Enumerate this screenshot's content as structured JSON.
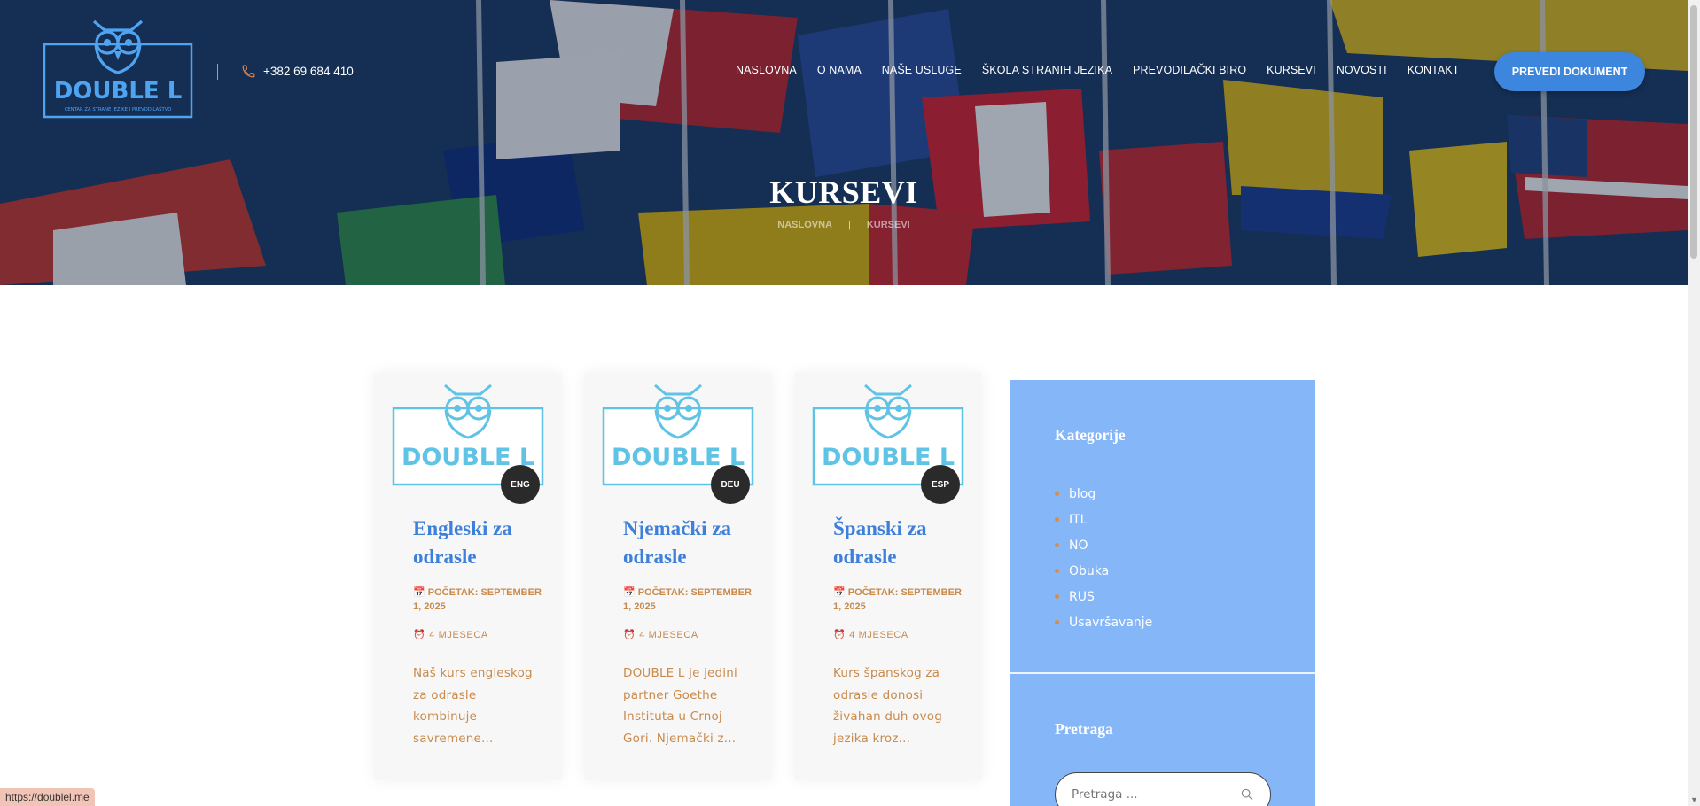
{
  "header": {
    "logo_text": "DOUBLE L",
    "logo_tagline": "CENTAR ZA STRANE JEZIKE I PREVODILAŠTVO",
    "phone": "+382 69 684 410",
    "nav": [
      "NASLOVNA",
      "O NAMA",
      "NAŠE USLUGE",
      "ŠKOLA STRANIH JEZIKA",
      "PREVODILAČKI BIRO",
      "KURSEVI",
      "NOVOSTI",
      "KONTAKT"
    ],
    "cta": "PREVEDI DOKUMENT",
    "page_title": "KURSEVI",
    "breadcrumb": [
      "NASLOVNA",
      "KURSEVI"
    ]
  },
  "courses": [
    {
      "badge": "ENG",
      "title": "Engleski za odrasle",
      "start": "POČETAK: SEPTEMBER 1, 2025",
      "duration": "4 MJESECA",
      "excerpt": "Naš kurs engleskog za odrasle kombinuje savremene..."
    },
    {
      "badge": "DEU",
      "title": "Njemački za odrasle",
      "start": "POČETAK: SEPTEMBER 1, 2025",
      "duration": "4 MJESECA",
      "excerpt": "DOUBLE L je jedini partner Goethe Instituta u Crnoj Gori. Njemački z..."
    },
    {
      "badge": "ESP",
      "title": "Španski za odrasle",
      "start": "POČETAK: SEPTEMBER 1, 2025",
      "duration": "4 MJESECA",
      "excerpt": "Kurs španskog za odrasle donosi živahan duh ovog jezika kroz..."
    }
  ],
  "sidebar": {
    "categories_title": "Kategorije",
    "categories": [
      "blog",
      "ITL",
      "NO",
      "Obuka",
      "RUS",
      "Usavršavanje"
    ],
    "search_title": "Pretraga",
    "search_placeholder": "Pretraga ..."
  },
  "status_url": "https://doublel.me",
  "colors": {
    "accent": "#3d86dd",
    "link": "#3d7fd9",
    "meta": "#c98a4b",
    "sidebar": "#85b6f8",
    "badge": "#2a2a2a"
  }
}
